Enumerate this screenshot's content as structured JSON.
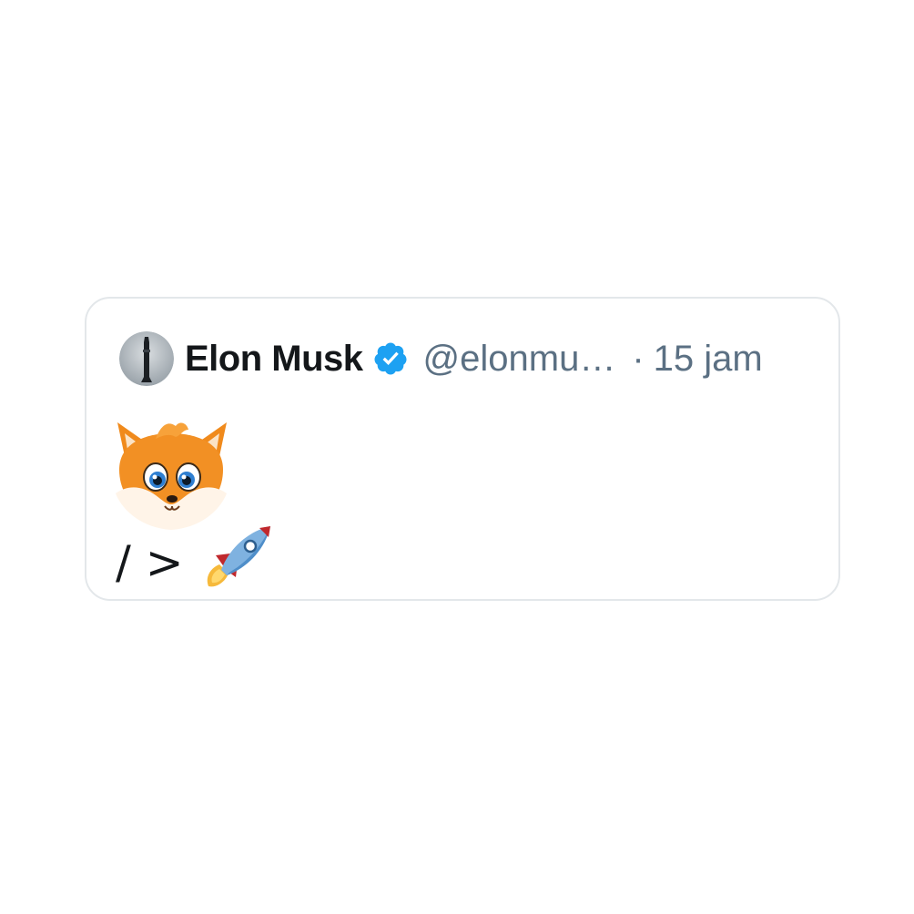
{
  "tweet": {
    "author": {
      "name": "Elon Musk",
      "handle": "@elonmu…",
      "verified": true,
      "avatar_icon": "rocket-avatar"
    },
    "separator": "·",
    "time": "15 jam",
    "text": "/ >",
    "emojis": [
      "fox-face-icon",
      "rocket-icon"
    ]
  },
  "colors": {
    "name": "#14171a",
    "meta": "#5b7083",
    "verified_badge": "#1da1f2",
    "border": "#e3e7ea"
  }
}
